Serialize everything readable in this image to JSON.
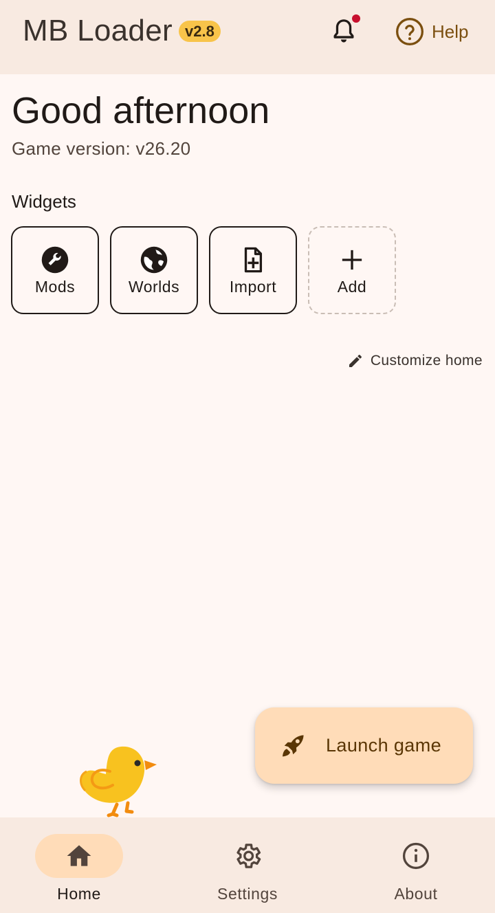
{
  "app_bar": {
    "title": "MB Loader",
    "version_badge": "v2.8",
    "notifications_icon": "bell-icon",
    "has_unread_notification": true,
    "help_label": "Help",
    "help_icon": "help-circle-icon"
  },
  "home": {
    "greeting": "Good afternoon",
    "game_version": "Game version: v26.20",
    "widgets_heading": "Widgets",
    "widgets": [
      {
        "label": "Mods",
        "icon": "wrench-icon"
      },
      {
        "label": "Worlds",
        "icon": "globe-icon"
      },
      {
        "label": "Import",
        "icon": "file-add-icon"
      },
      {
        "label": "Add",
        "icon": "plus-icon"
      }
    ],
    "customize_label": "Customize home",
    "customize_icon": "pencil-icon"
  },
  "fab": {
    "label": "Launch game",
    "icon": "rocket-icon"
  },
  "mascot_icon": "chick-icon",
  "bottom_nav": {
    "active": "Home",
    "items": [
      {
        "label": "Home",
        "icon": "home-icon"
      },
      {
        "label": "Settings",
        "icon": "gear-icon"
      },
      {
        "label": "About",
        "icon": "info-icon"
      }
    ]
  },
  "colors": {
    "background": "#fff7f4",
    "surface_container": "#f8eae1",
    "accent_container": "#ffdcb8",
    "badge": "#f8c44a",
    "help_text": "#7b4f0f",
    "notification_dot": "#c8102e"
  }
}
